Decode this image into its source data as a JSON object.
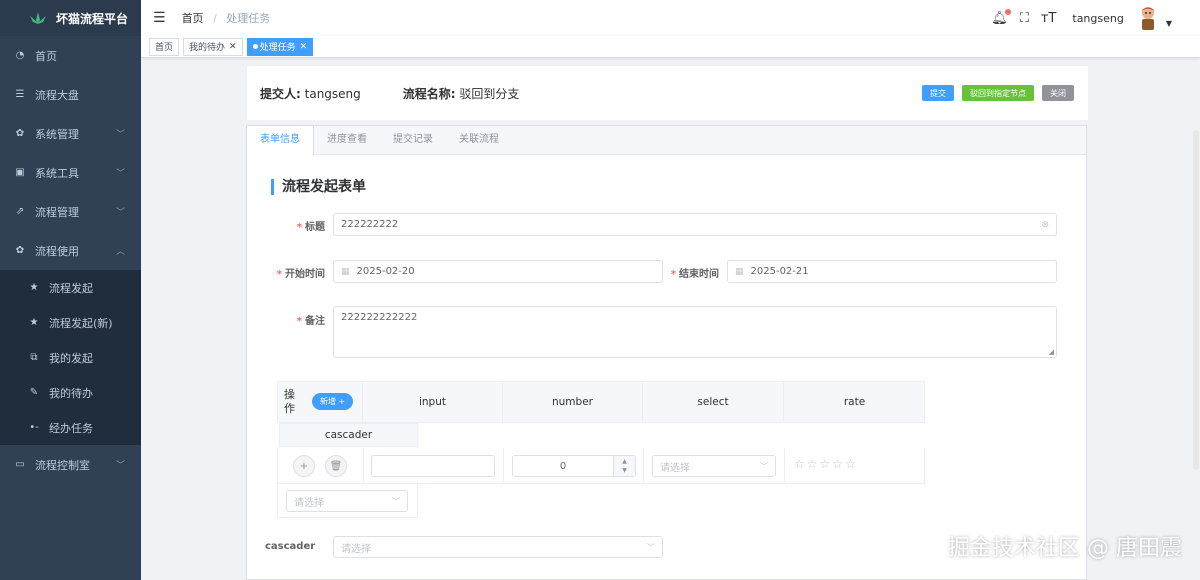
{
  "app": {
    "title": "坏猫流程平台"
  },
  "sidebar": {
    "items": [
      {
        "label": "首页",
        "icon": "dashboard-icon"
      },
      {
        "label": "流程大盘",
        "icon": "list-icon"
      },
      {
        "label": "系统管理",
        "icon": "gear-icon"
      },
      {
        "label": "系统工具",
        "icon": "toolbox-icon"
      },
      {
        "label": "流程管理",
        "icon": "flow-icon"
      },
      {
        "label": "流程使用",
        "icon": "gear-icon"
      },
      {
        "label": "流程控制室",
        "icon": "monitor-icon"
      }
    ],
    "subitems": [
      {
        "label": "流程发起",
        "icon": "star-icon"
      },
      {
        "label": "流程发起(新)",
        "icon": "star-icon"
      },
      {
        "label": "我的发起",
        "icon": "external-link-icon"
      },
      {
        "label": "我的待办",
        "icon": "edit-icon"
      },
      {
        "label": "经办任务",
        "icon": "dots-icon"
      }
    ]
  },
  "navbar": {
    "breadcrumb": [
      "首页",
      "处理任务"
    ],
    "separator": "/",
    "username": "tangseng"
  },
  "tags": [
    {
      "label": "首页",
      "active": false
    },
    {
      "label": "我的待办",
      "active": false
    },
    {
      "label": "处理任务",
      "active": true
    }
  ],
  "header": {
    "submitter_label": "提交人:",
    "submitter": "tangseng",
    "flow_name_label": "流程名称:",
    "flow_name": "驳回到分支",
    "buttons": {
      "submit": "提交",
      "reject": "驳回到指定节点",
      "close": "关闭"
    }
  },
  "tabs": [
    "表单信息",
    "进度查看",
    "提交记录",
    "关联流程"
  ],
  "form": {
    "title": "流程发起表单",
    "fields": {
      "title_label": "标题",
      "title_value": "222222222",
      "start_label": "开始时间",
      "start_value": "2025-02-20",
      "end_label": "结束时间",
      "end_value": "2025-02-21",
      "remark_label": "备注",
      "remark_value": "222222222222",
      "cascader_label": "cascader",
      "cascader_placeholder": "请选择"
    },
    "subtable": {
      "op_label": "操作",
      "add_label": "新增 +",
      "columns": [
        "input",
        "number",
        "select",
        "rate",
        "cascader"
      ],
      "row": {
        "input": "",
        "number": "0",
        "select_placeholder": "请选择",
        "rate": 0,
        "cascader_placeholder": "请选择"
      }
    }
  },
  "watermark": "掘金技术社区 @ 唐田震"
}
